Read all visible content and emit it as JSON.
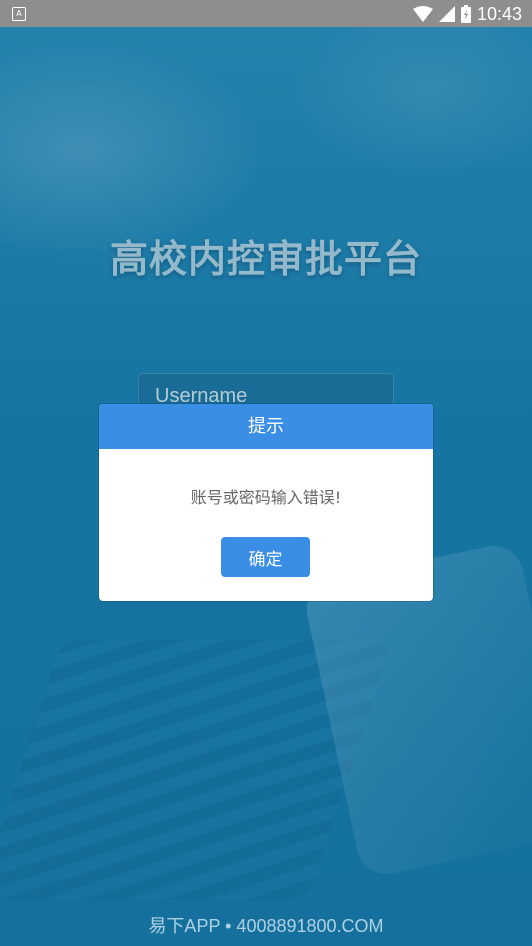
{
  "status_bar": {
    "notification_letter": "A",
    "time": "10:43",
    "icons": [
      "wifi-icon",
      "signal-icon",
      "battery-icon"
    ]
  },
  "login": {
    "title": "高校内控审批平台",
    "username_placeholder": "Username"
  },
  "dialog": {
    "title": "提示",
    "message": "账号或密码输入错误!",
    "confirm_label": "确定"
  },
  "watermark": "易下APP • 4008891800.COM",
  "colors": {
    "accent": "#3a8ee6",
    "background": "#1d86b8",
    "status_bar": "#8e8e8e"
  }
}
